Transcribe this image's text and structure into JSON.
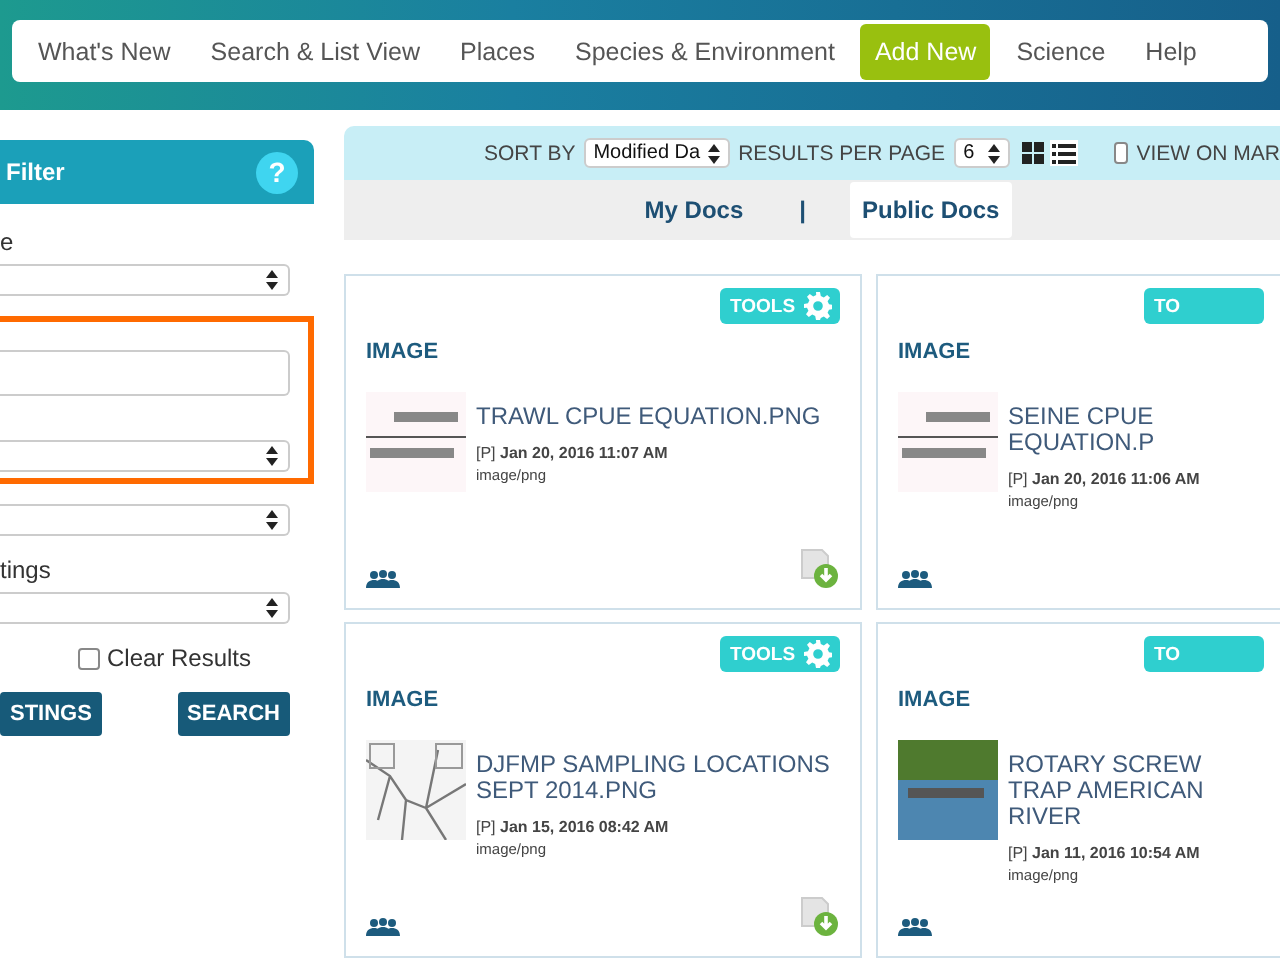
{
  "nav": {
    "items": [
      {
        "label": "What's New",
        "selected": false
      },
      {
        "label": "Search & List View",
        "selected": false
      },
      {
        "label": "Places",
        "selected": false
      },
      {
        "label": "Species & Environment",
        "selected": false
      },
      {
        "label": "Add New",
        "selected": true
      },
      {
        "label": "Science",
        "selected": false
      },
      {
        "label": "Help",
        "selected": false
      }
    ]
  },
  "filter": {
    "title": "Filter",
    "help": "?",
    "fields": [
      {
        "kind": "select",
        "label": "e"
      },
      {
        "kind": "input",
        "highlighted": true
      },
      {
        "kind": "select",
        "highlighted": true
      },
      {
        "kind": "select"
      },
      {
        "kind": "select",
        "label": "tings"
      }
    ],
    "clear_results": {
      "label": "Clear Results",
      "checked": false
    },
    "buttons": [
      "STINGS",
      "SEARCH"
    ]
  },
  "toolbar": {
    "sort_label": "SORT BY",
    "sort_value": "Modified Da",
    "per_page_label": "RESULTS PER PAGE",
    "per_page_value": "6",
    "view_on_map": {
      "label": "VIEW ON MAR",
      "checked": false
    }
  },
  "doc_tabs": {
    "items": [
      {
        "label": "My Docs",
        "selected": false
      },
      {
        "label": "Public Docs",
        "selected": true
      }
    ],
    "separator": "|"
  },
  "cards": [
    {
      "tools": "TOOLS",
      "type": "IMAGE",
      "kind": "equation",
      "title": "TRAWL CPUE EQUATION.PNG",
      "visibility": "[P]",
      "date": "Jan 20, 2016 11:07 AM",
      "mime": "image/png"
    },
    {
      "tools": "TO",
      "type": "IMAGE",
      "kind": "equation",
      "title": "SEINE CPUE EQUATION.P",
      "visibility": "[P]",
      "date": "Jan 20, 2016 11:06 AM",
      "mime": "image/png"
    },
    {
      "tools": "TOOLS",
      "type": "IMAGE",
      "kind": "map",
      "title": "DJFMP SAMPLING LOCATIONS SEPT 2014.PNG",
      "visibility": "[P]",
      "date": "Jan 15, 2016 08:42 AM",
      "mime": "image/png"
    },
    {
      "tools": "TO",
      "type": "IMAGE",
      "kind": "photo",
      "title": "ROTARY SCREW TRAP AMERICAN RIVER",
      "visibility": "[P]",
      "date": "Jan 11, 2016 10:54 AM",
      "mime": "image/png"
    }
  ]
}
